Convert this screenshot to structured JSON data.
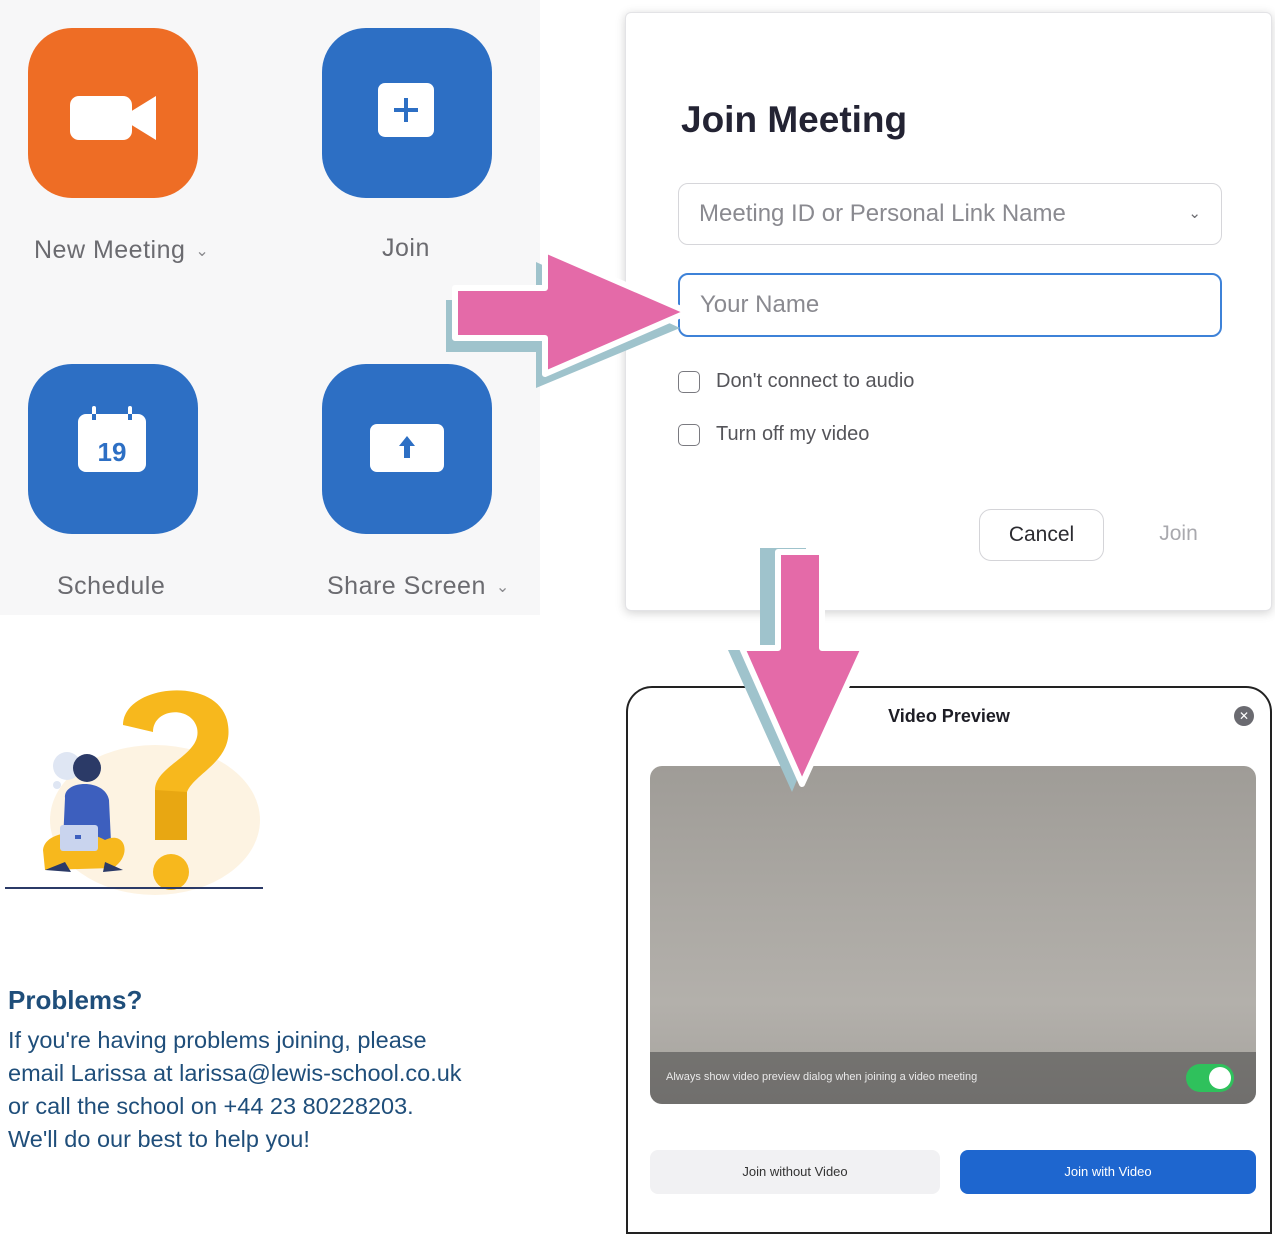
{
  "home": {
    "new_meeting_label": "New Meeting",
    "join_label": "Join",
    "schedule_label": "Schedule",
    "share_screen_label": "Share Screen",
    "calendar_day": "19",
    "chevron": "⌄"
  },
  "join_dialog": {
    "title": "Join Meeting",
    "meeting_id_placeholder": "Meeting ID or Personal Link Name",
    "name_placeholder": "Your Name",
    "option_audio": "Don't connect to audio",
    "option_video": "Turn off my video",
    "cancel_label": "Cancel",
    "join_label": "Join"
  },
  "help": {
    "title": "Problems?",
    "lines": [
      "If you're having problems joining, please",
      "email Larissa at larissa@lewis-school.co.uk",
      "or call the school on +44 23 80228203.",
      "We'll do our best to help you!"
    ]
  },
  "video_preview": {
    "title": "Video Preview",
    "always_show_text": "Always show video preview dialog when joining a video meeting",
    "toggle_on": true,
    "join_without_video": "Join without Video",
    "join_with_video": "Join with Video"
  },
  "colors": {
    "orange_tile": "#ee6d25",
    "blue_tile": "#2d6fc4",
    "arrow_pink": "#e46aa8",
    "arrow_shadow": "#9fc3cc",
    "help_text": "#1f4e7a",
    "primary_blue": "#1e66cf",
    "toggle_green": "#2fc15c"
  },
  "icons": [
    "video-camera-icon",
    "plus-icon",
    "calendar-icon",
    "upload-arrow-icon",
    "close-icon",
    "chevron-down-icon"
  ]
}
